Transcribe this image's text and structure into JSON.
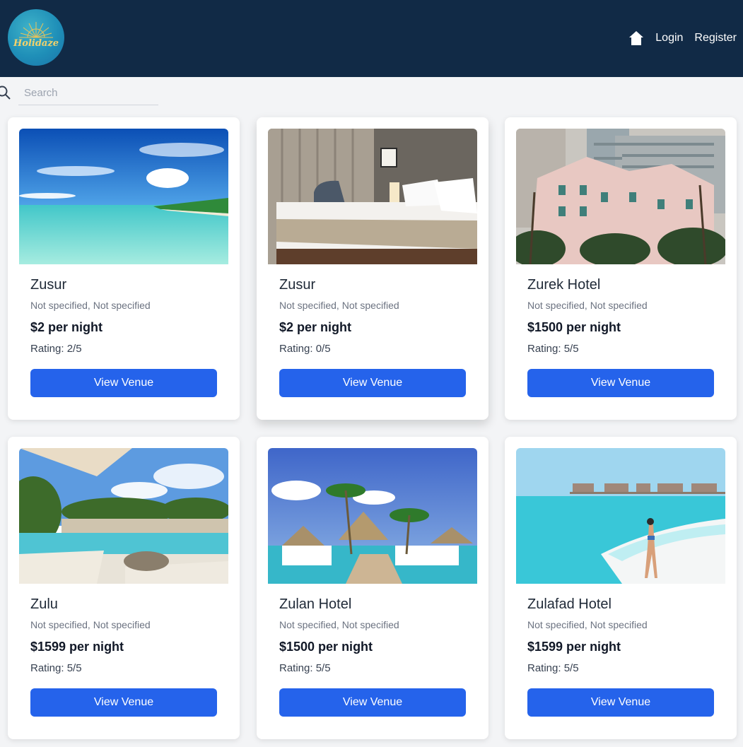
{
  "header": {
    "logo_text": "Holidaze",
    "nav": {
      "home_icon": "home-icon",
      "login": "Login",
      "register": "Register"
    }
  },
  "search": {
    "placeholder": "Search",
    "icon": "search-icon"
  },
  "venues": [
    {
      "name": "Zusur",
      "location": "Not specified, Not specified",
      "price": "$2 per night",
      "rating": "Rating: 2/5",
      "button": "View Venue"
    },
    {
      "name": "Zusur",
      "location": "Not specified, Not specified",
      "price": "$2 per night",
      "rating": "Rating: 0/5",
      "button": "View Venue"
    },
    {
      "name": "Zurek Hotel",
      "location": "Not specified, Not specified",
      "price": "$1500 per night",
      "rating": "Rating: 5/5",
      "button": "View Venue"
    },
    {
      "name": "Zulu",
      "location": "Not specified, Not specified",
      "price": "$1599 per night",
      "rating": "Rating: 5/5",
      "button": "View Venue"
    },
    {
      "name": "Zulan Hotel",
      "location": "Not specified, Not specified",
      "price": "$1500 per night",
      "rating": "Rating: 5/5",
      "button": "View Venue"
    },
    {
      "name": "Zulafad Hotel",
      "location": "Not specified, Not specified",
      "price": "$1599 per night",
      "rating": "Rating: 5/5",
      "button": "View Venue"
    }
  ],
  "colors": {
    "header_bg": "#112a46",
    "page_bg": "#f3f4f6",
    "button": "#2563eb",
    "logo_text": "#f2d16b"
  }
}
